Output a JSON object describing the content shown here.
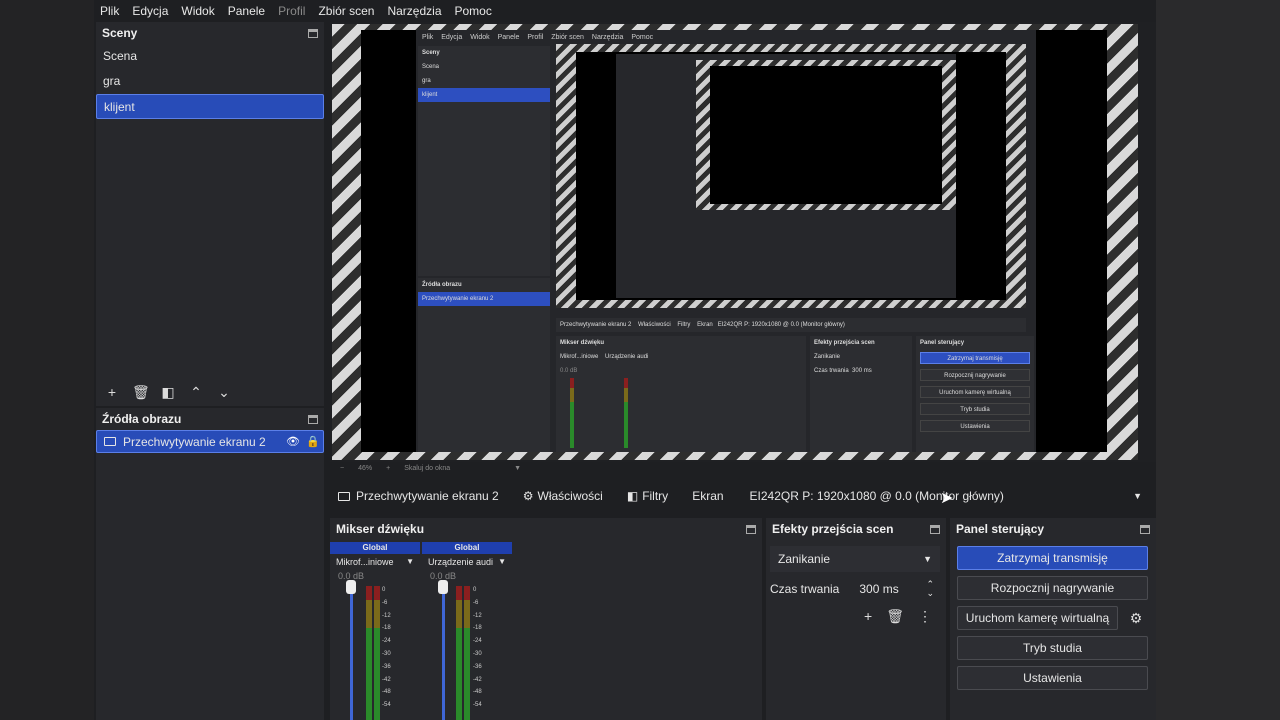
{
  "menu": [
    "Plik",
    "Edycja",
    "Widok",
    "Panele",
    "Profil",
    "Zbiór scen",
    "Narzędzia",
    "Pomoc"
  ],
  "scenes": {
    "title": "Sceny",
    "items": [
      "Scena",
      "gra",
      "klijent"
    ],
    "active": "klijent"
  },
  "sources": {
    "title": "Źródła obrazu",
    "items": [
      {
        "label": "Przechwytywanie ekranu 2"
      }
    ]
  },
  "preview": {
    "zoom": "46%",
    "scale_label": "Skaluj do okna",
    "nested_menu": [
      "Plik",
      "Edycja",
      "Widok",
      "Panele",
      "Profil",
      "Zbiór scen",
      "Narzędzia",
      "Pomoc"
    ],
    "nested_scenes": [
      "Scena",
      "gra",
      "klijent"
    ],
    "nested_source": "Przechwytywanie ekranu 2",
    "nested_screen": "EI242QR P: 1920x1080 @ 0.0 (Monitor główny)",
    "nested_buttons": [
      "Zatrzymaj transmisję",
      "Rozpocznij nagrywanie",
      "Uruchom kamerę wirtualną",
      "Tryb studia",
      "Ustawienia"
    ],
    "nested_headers": [
      "Sceny",
      "Źródła obrazu",
      "Mikser dźwięku",
      "Efekty przejścia scen",
      "Panel sterujący"
    ],
    "nested_toolbar": [
      "Przechwytywanie ekranu 2",
      "Właściwości",
      "Filtry",
      "Ekran"
    ],
    "nested_mixer": [
      "Mikrof...iniowe",
      "Urządzenie audi",
      "0.0 dB"
    ],
    "nested_transition": [
      "Zanikanie",
      "Czas trwania",
      "300 ms"
    ]
  },
  "source_toolbar": {
    "source_name": "Przechwytywanie ekranu 2",
    "properties": "Właściwości",
    "filters": "Filtry",
    "screen_label": "Ekran",
    "screen_value": "EI242QR P: 1920x1080 @ 0.0 (Monitor główny)"
  },
  "mixer": {
    "title": "Mikser dźwięku",
    "channels": [
      {
        "group": "Global",
        "name": "Mikrof...iniowe",
        "db": "0.0 dB"
      },
      {
        "group": "Global",
        "name": "Urządzenie audi",
        "db": "0.0 dB"
      }
    ],
    "ticks": [
      "0",
      "-6",
      "-12",
      "-18",
      "-24",
      "-30",
      "-36",
      "-42",
      "-48",
      "-54"
    ]
  },
  "transitions": {
    "title": "Efekty przejścia scen",
    "selected": "Zanikanie",
    "duration_label": "Czas trwania",
    "duration_value": "300 ms"
  },
  "controls": {
    "title": "Panel sterujący",
    "stop_stream": "Zatrzymaj transmisję",
    "start_record": "Rozpocznij nagrywanie",
    "virtual_cam": "Uruchom kamerę wirtualną",
    "studio_mode": "Tryb studia",
    "settings": "Ustawienia"
  }
}
